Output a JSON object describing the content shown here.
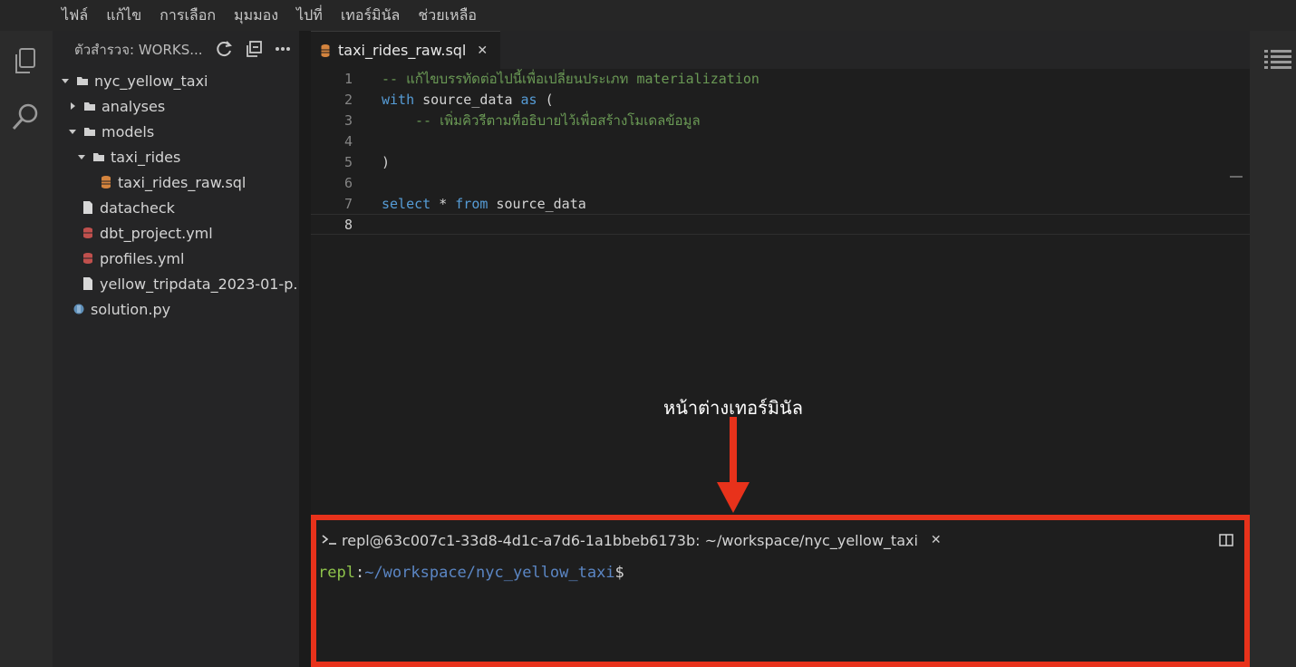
{
  "menubar": {
    "items": [
      "ไฟล์",
      "แก้ไข",
      "การเลือก",
      "มุมมอง",
      "ไปที่",
      "เทอร์มินัล",
      "ช่วยเหลือ"
    ]
  },
  "activitybar": {
    "icons": [
      "files-icon",
      "search-icon"
    ]
  },
  "sidebar": {
    "title": "ตัวสำรวจ: WORKS...",
    "tree": [
      {
        "label": "nyc_yellow_taxi",
        "type": "folder",
        "expanded": true
      },
      {
        "label": "analyses",
        "type": "folder",
        "expanded": false
      },
      {
        "label": "models",
        "type": "folder",
        "expanded": true
      },
      {
        "label": "taxi_rides",
        "type": "folder",
        "expanded": true
      },
      {
        "label": "taxi_rides_raw.sql",
        "type": "sql"
      },
      {
        "label": "datacheck",
        "type": "file"
      },
      {
        "label": "dbt_project.yml",
        "type": "yml"
      },
      {
        "label": "profiles.yml",
        "type": "yml"
      },
      {
        "label": "yellow_tripdata_2023-01-p...",
        "type": "file"
      },
      {
        "label": "solution.py",
        "type": "py"
      }
    ]
  },
  "editor": {
    "tab_label": "taxi_rides_raw.sql",
    "line_numbers": [
      "1",
      "2",
      "3",
      "4",
      "5",
      "6",
      "7",
      "8"
    ],
    "lines": {
      "l1_comment": "-- แก้ไขบรรทัดต่อไปนี้เพื่อเปลี่ยนประเภท materialization",
      "l2_with": "with",
      "l2_name": " source_data ",
      "l2_as": "as",
      "l2_paren": " (",
      "l3_comment": "-- เพิ่มคิวรีตามที่อธิบายไว้เพื่อสร้างโมเดลข้อมูล",
      "l5_paren": ")",
      "l7_select": "select",
      "l7_star": " * ",
      "l7_from": "from",
      "l7_name": " source_data"
    }
  },
  "terminal": {
    "title": "repl@63c007c1-33d8-4d1c-a7d6-1a1bbeb6173b: ~/workspace/nyc_yellow_taxi",
    "prompt_user": "repl",
    "prompt_sep": ":",
    "prompt_path": "~/workspace/nyc_yellow_taxi",
    "prompt_symbol": "$"
  },
  "annotation": {
    "label": "หน้าต่างเทอร์มินัล",
    "color": "#e8321b"
  },
  "colors": {
    "highlight_border": "#e8321b",
    "comment": "#6a9955",
    "keyword": "#569cd6",
    "prompt_user": "#8ec34b",
    "prompt_path": "#5b86c4"
  }
}
